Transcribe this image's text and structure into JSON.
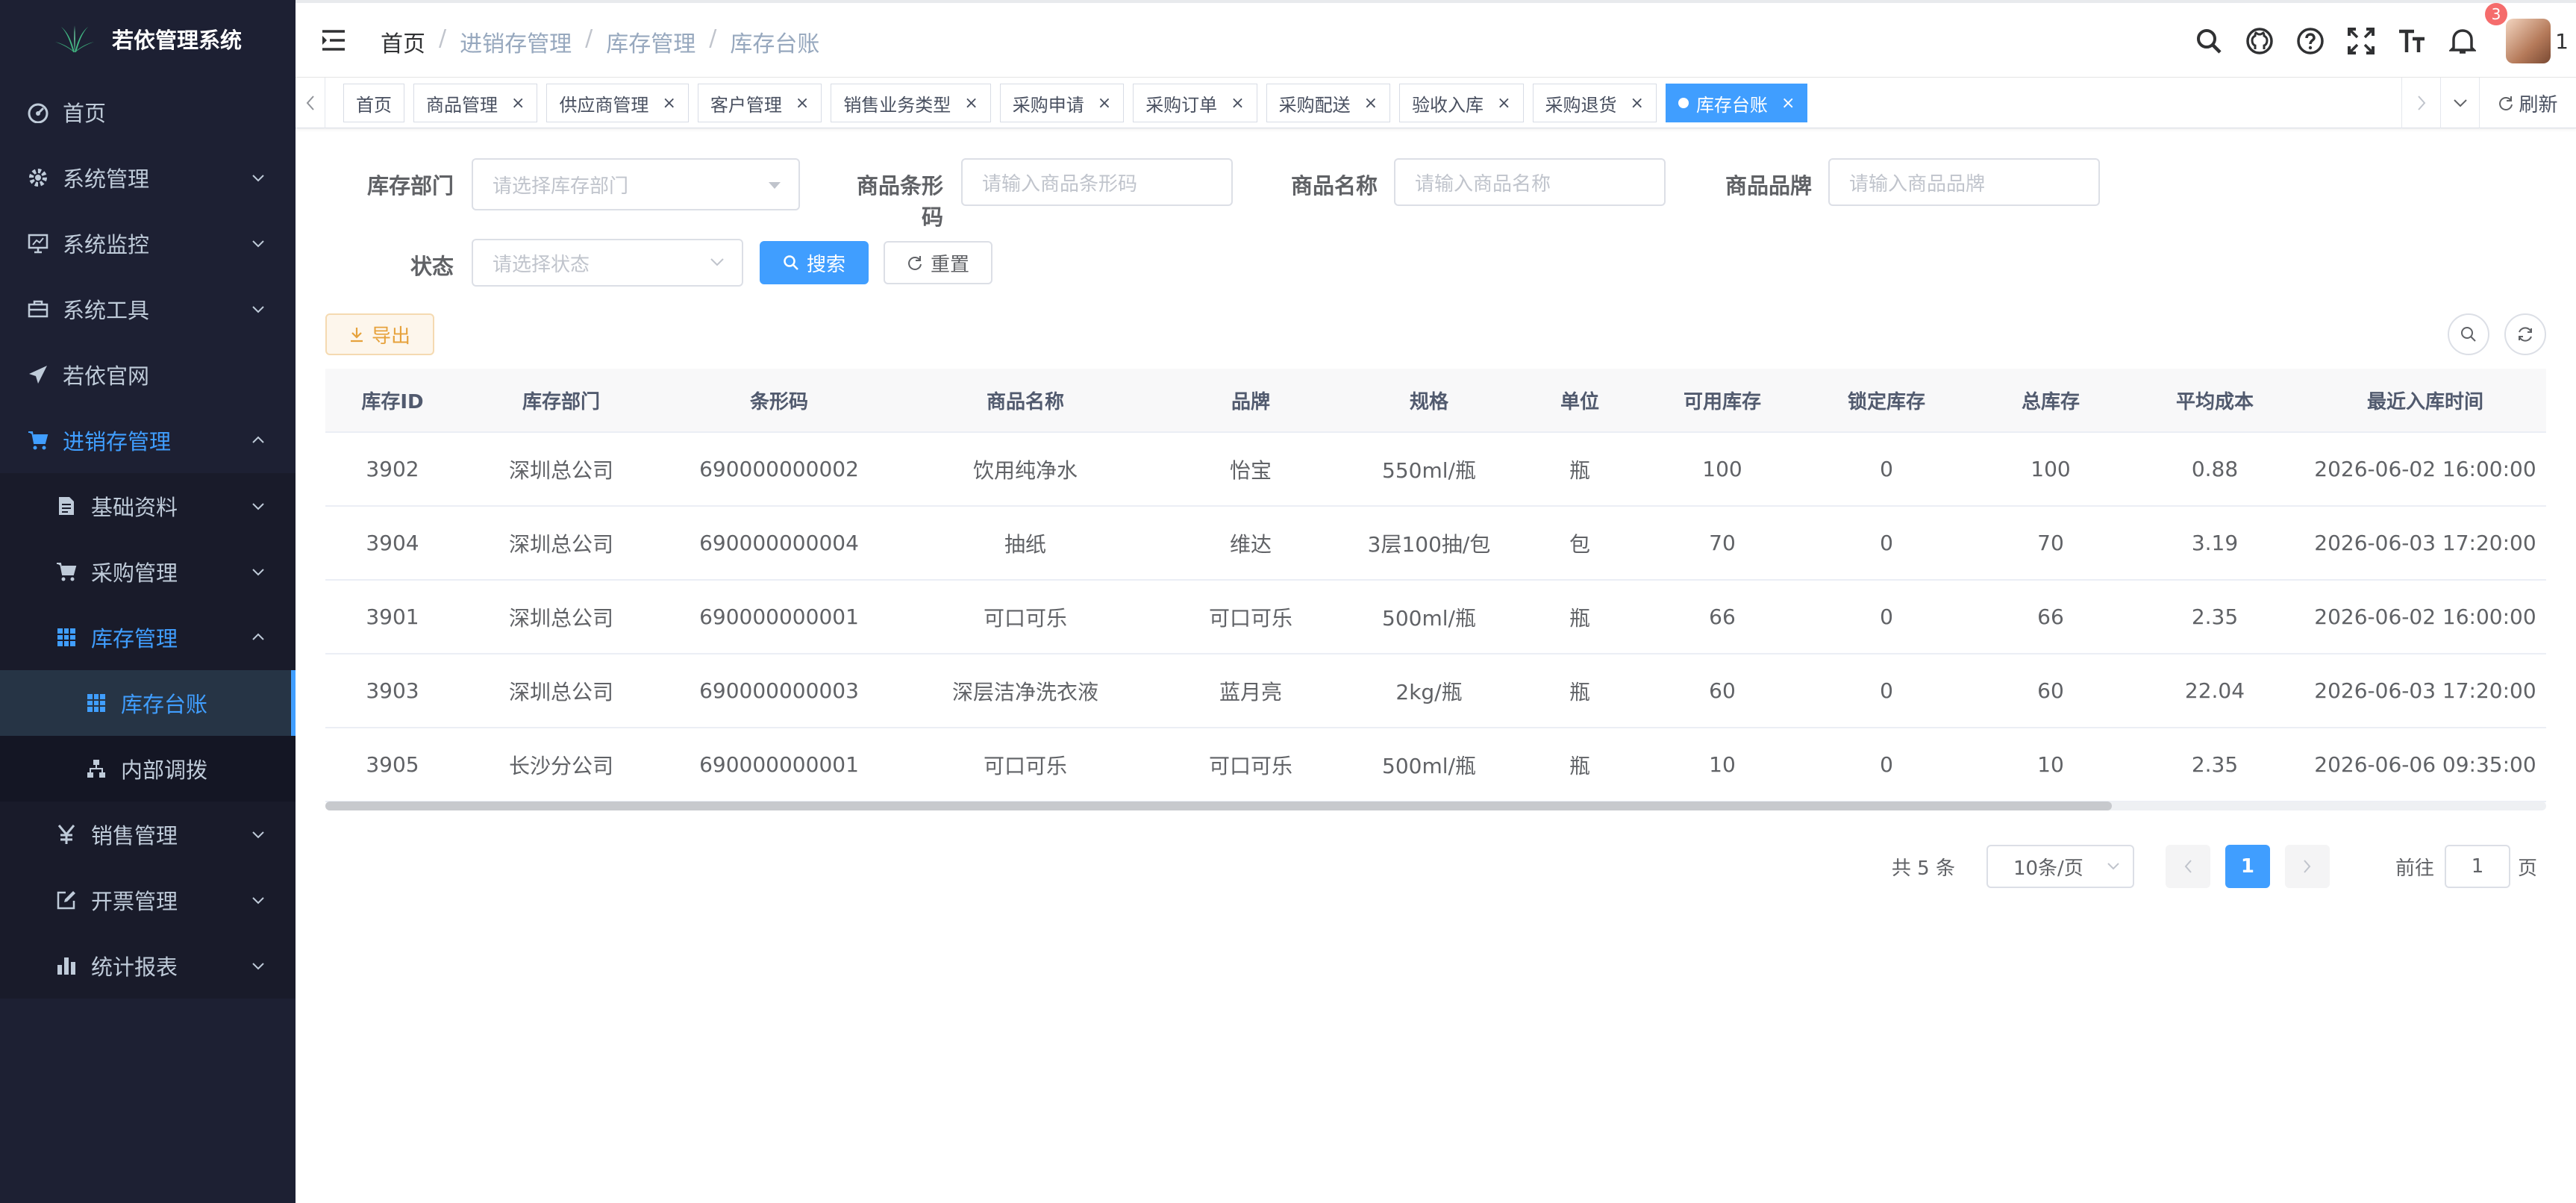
{
  "app": {
    "title": "若依管理系统"
  },
  "sidebar": {
    "items": [
      {
        "label": "首页",
        "icon": "dashboard-icon"
      },
      {
        "label": "系统管理",
        "icon": "gear-icon"
      },
      {
        "label": "系统监控",
        "icon": "monitor-icon"
      },
      {
        "label": "系统工具",
        "icon": "toolbox-icon"
      },
      {
        "label": "若依官网",
        "icon": "paper-plane-icon"
      },
      {
        "label": "进销存管理",
        "icon": "cart-icon"
      },
      {
        "label": "基础资料",
        "icon": "document-icon"
      },
      {
        "label": "采购管理",
        "icon": "cart-icon"
      },
      {
        "label": "库存管理",
        "icon": "table-icon"
      },
      {
        "label": "库存台账",
        "icon": "table-icon"
      },
      {
        "label": "内部调拨",
        "icon": "tree-icon"
      },
      {
        "label": "销售管理",
        "icon": "yen-icon"
      },
      {
        "label": "开票管理",
        "icon": "edit-icon"
      },
      {
        "label": "统计报表",
        "icon": "bar-chart-icon"
      }
    ]
  },
  "breadcrumb": [
    "首页",
    "进销存管理",
    "库存管理",
    "库存台账"
  ],
  "navbar": {
    "badge_count": "3",
    "user": "1"
  },
  "tags": [
    {
      "label": "首页",
      "closable": false,
      "active": false
    },
    {
      "label": "商品管理",
      "closable": true,
      "active": false
    },
    {
      "label": "供应商管理",
      "closable": true,
      "active": false
    },
    {
      "label": "客户管理",
      "closable": true,
      "active": false
    },
    {
      "label": "销售业务类型",
      "closable": true,
      "active": false
    },
    {
      "label": "采购申请",
      "closable": true,
      "active": false
    },
    {
      "label": "采购订单",
      "closable": true,
      "active": false
    },
    {
      "label": "采购配送",
      "closable": true,
      "active": false
    },
    {
      "label": "验收入库",
      "closable": true,
      "active": false
    },
    {
      "label": "采购退货",
      "closable": true,
      "active": false
    },
    {
      "label": "库存台账",
      "closable": true,
      "active": true
    }
  ],
  "tags_refresh": "刷新",
  "form": {
    "dept_label": "库存部门",
    "dept_placeholder": "请选择库存部门",
    "barcode_label": "商品条形码",
    "barcode_placeholder": "请输入商品条形码",
    "name_label": "商品名称",
    "name_placeholder": "请输入商品名称",
    "brand_label": "商品品牌",
    "brand_placeholder": "请输入商品品牌",
    "status_label": "状态",
    "status_placeholder": "请选择状态",
    "search_btn": "搜索",
    "reset_btn": "重置"
  },
  "toolbar": {
    "export_btn": "导出"
  },
  "table": {
    "columns": [
      "库存ID",
      "库存部门",
      "条形码",
      "商品名称",
      "品牌",
      "规格",
      "单位",
      "可用库存",
      "锁定库存",
      "总库存",
      "平均成本",
      "最近入库时间"
    ],
    "rows": [
      [
        "3902",
        "深圳总公司",
        "690000000002",
        "饮用纯净水",
        "怡宝",
        "550ml/瓶",
        "瓶",
        "100",
        "0",
        "100",
        "0.88",
        "2026-06-02 16:00:00"
      ],
      [
        "3904",
        "深圳总公司",
        "690000000004",
        "抽纸",
        "维达",
        "3层100抽/包",
        "包",
        "70",
        "0",
        "70",
        "3.19",
        "2026-06-03 17:20:00"
      ],
      [
        "3901",
        "深圳总公司",
        "690000000001",
        "可口可乐",
        "可口可乐",
        "500ml/瓶",
        "瓶",
        "66",
        "0",
        "66",
        "2.35",
        "2026-06-02 16:00:00"
      ],
      [
        "3903",
        "深圳总公司",
        "690000000003",
        "深层洁净洗衣液",
        "蓝月亮",
        "2kg/瓶",
        "瓶",
        "60",
        "0",
        "60",
        "22.04",
        "2026-06-03 17:20:00"
      ],
      [
        "3905",
        "长沙分公司",
        "690000000001",
        "可口可乐",
        "可口可乐",
        "500ml/瓶",
        "瓶",
        "10",
        "0",
        "10",
        "2.35",
        "2026-06-06 09:35:00"
      ]
    ]
  },
  "pagination": {
    "total": "共 5 条",
    "page_size": "10条/页",
    "current": "1",
    "goto": "前往",
    "goto_value": "1",
    "unit": "页"
  },
  "colors": {
    "primary": "#409eff",
    "sidebar_bg": "#1d2033",
    "warning": "#e6a23c",
    "danger": "#f56c6c"
  }
}
